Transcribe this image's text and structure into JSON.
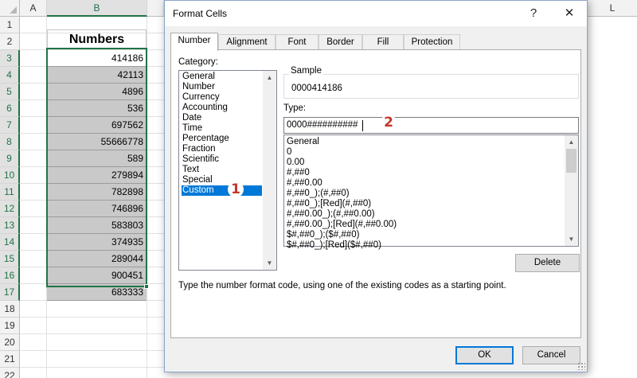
{
  "sheet": {
    "columns": [
      "A",
      "B",
      "L"
    ],
    "rows": [
      "1",
      "2",
      "3",
      "4",
      "5",
      "6",
      "7",
      "8",
      "9",
      "10",
      "11",
      "12",
      "13",
      "14",
      "15",
      "16",
      "17",
      "18",
      "19",
      "20",
      "21",
      "22"
    ],
    "header": "Numbers",
    "values": [
      "414186",
      "42113",
      "4896",
      "536",
      "697562",
      "55666778",
      "589",
      "279894",
      "782898",
      "746896",
      "583803",
      "374935",
      "289044",
      "900451",
      "683333"
    ]
  },
  "dialog": {
    "title": "Format Cells",
    "help": "?",
    "close": "✕",
    "tabs": [
      "Number",
      "Alignment",
      "Font",
      "Border",
      "Fill",
      "Protection"
    ],
    "category_label": "Category:",
    "categories": [
      "General",
      "Number",
      "Currency",
      "Accounting",
      "Date",
      "Time",
      "Percentage",
      "Fraction",
      "Scientific",
      "Text",
      "Special",
      "Custom"
    ],
    "selected_category": "Custom",
    "sample_label": "Sample",
    "sample_value": "0000414186",
    "type_label": "Type:",
    "type_value": "0000##########",
    "format_codes": [
      "General",
      "0",
      "0.00",
      "#,##0",
      "#,##0.00",
      "#,##0_);(#,##0)",
      "#,##0_);[Red](#,##0)",
      "#,##0.00_);(#,##0.00)",
      "#,##0.00_);[Red](#,##0.00)",
      "$#,##0_);($#,##0)",
      "$#,##0_);[Red]($#,##0)"
    ],
    "delete_label": "Delete",
    "hint": "Type the number format code, using one of the existing codes as a starting point.",
    "ok_label": "OK",
    "cancel_label": "Cancel"
  },
  "annotations": {
    "step1": "1",
    "step2": "2"
  },
  "colors": {
    "excel_green": "#217346",
    "selection_blue": "#0078d7",
    "badge_red": "#c0392b",
    "cell_grey": "#c9c9c9"
  }
}
